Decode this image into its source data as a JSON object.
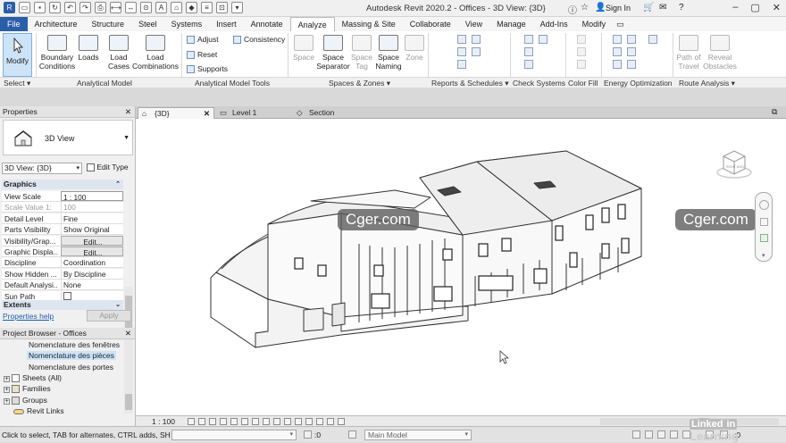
{
  "title": "Autodesk Revit 2020.2 - Offices - 3D View: {3D}",
  "signin": "Sign In",
  "tabs": {
    "file": "File",
    "architecture": "Architecture",
    "structure": "Structure",
    "steel": "Steel",
    "systems": "Systems",
    "insert": "Insert",
    "annotate": "Annotate",
    "analyze": "Analyze",
    "massing": "Massing & Site",
    "collaborate": "Collaborate",
    "view": "View",
    "manage": "Manage",
    "addins": "Add-Ins",
    "modify": "Modify"
  },
  "ribbon": {
    "modify": "Modify",
    "boundary_conditions": "Boundary\nConditions",
    "loads": "Loads",
    "load_cases": "Load\nCases",
    "load_combinations": "Load\nCombinations",
    "adjust": "Adjust",
    "consistency": "Consistency",
    "reset": "Reset",
    "supports": "Supports",
    "space": "Space",
    "space_separator": "Space\nSeparator",
    "space_tag": "Space\nTag",
    "space_naming": "Space\nNaming",
    "zone": "Zone",
    "path_of_travel": "Path of\nTravel",
    "reveal_obstacles": "Reveal\nObstacles"
  },
  "panels": {
    "select": "Select",
    "analytical_model": "Analytical Model",
    "analytical_tools": "Analytical Model Tools",
    "spaces_zones": "Spaces & Zones",
    "reports": "Reports & Schedules",
    "check_systems": "Check Systems",
    "color_fill": "Color Fill",
    "energy": "Energy Optimization",
    "route": "Route Analysis"
  },
  "properties": {
    "header": "Properties",
    "type_name": "3D View",
    "view_selector": "3D View: {3D}",
    "edit_type": "Edit Type",
    "group_graphics": "Graphics",
    "rows": [
      {
        "k": "View Scale",
        "v": "1 : 100"
      },
      {
        "k": "Scale Value    1:",
        "v": "100"
      },
      {
        "k": "Detail Level",
        "v": "Fine"
      },
      {
        "k": "Parts Visibility",
        "v": "Show Original"
      },
      {
        "k": "Visibility/Grap...",
        "v": "Edit..."
      },
      {
        "k": "Graphic Displa...",
        "v": "Edit..."
      },
      {
        "k": "Discipline",
        "v": "Coordination"
      },
      {
        "k": "Show Hidden ...",
        "v": "By Discipline"
      },
      {
        "k": "Default Analysi...",
        "v": "None"
      },
      {
        "k": "Sun Path",
        "v": ""
      }
    ],
    "group_extents": "Extents",
    "help": "Properties help",
    "apply": "Apply"
  },
  "browser": {
    "header": "Project Browser - Offices",
    "items": [
      "Nomenclature des fenêtres",
      "Nomenclature des pièces",
      "Nomenclature des portes",
      "Sheets (All)",
      "Families",
      "Groups",
      "Revit Links"
    ]
  },
  "view_tabs": [
    "{3D}",
    "Level 1",
    "Section"
  ],
  "watermark": "Cger.com",
  "viewcube_labels": {
    "front": "RIGHT",
    "side": "BACK"
  },
  "scale": "1 : 100",
  "status": {
    "text": "Click to select, TAB for alternates, CTRL adds, SH",
    "zero": ":0",
    "model": "Main Model"
  },
  "linkedin": {
    "a": "Linked",
    "b": "in",
    "c": " Learning"
  }
}
